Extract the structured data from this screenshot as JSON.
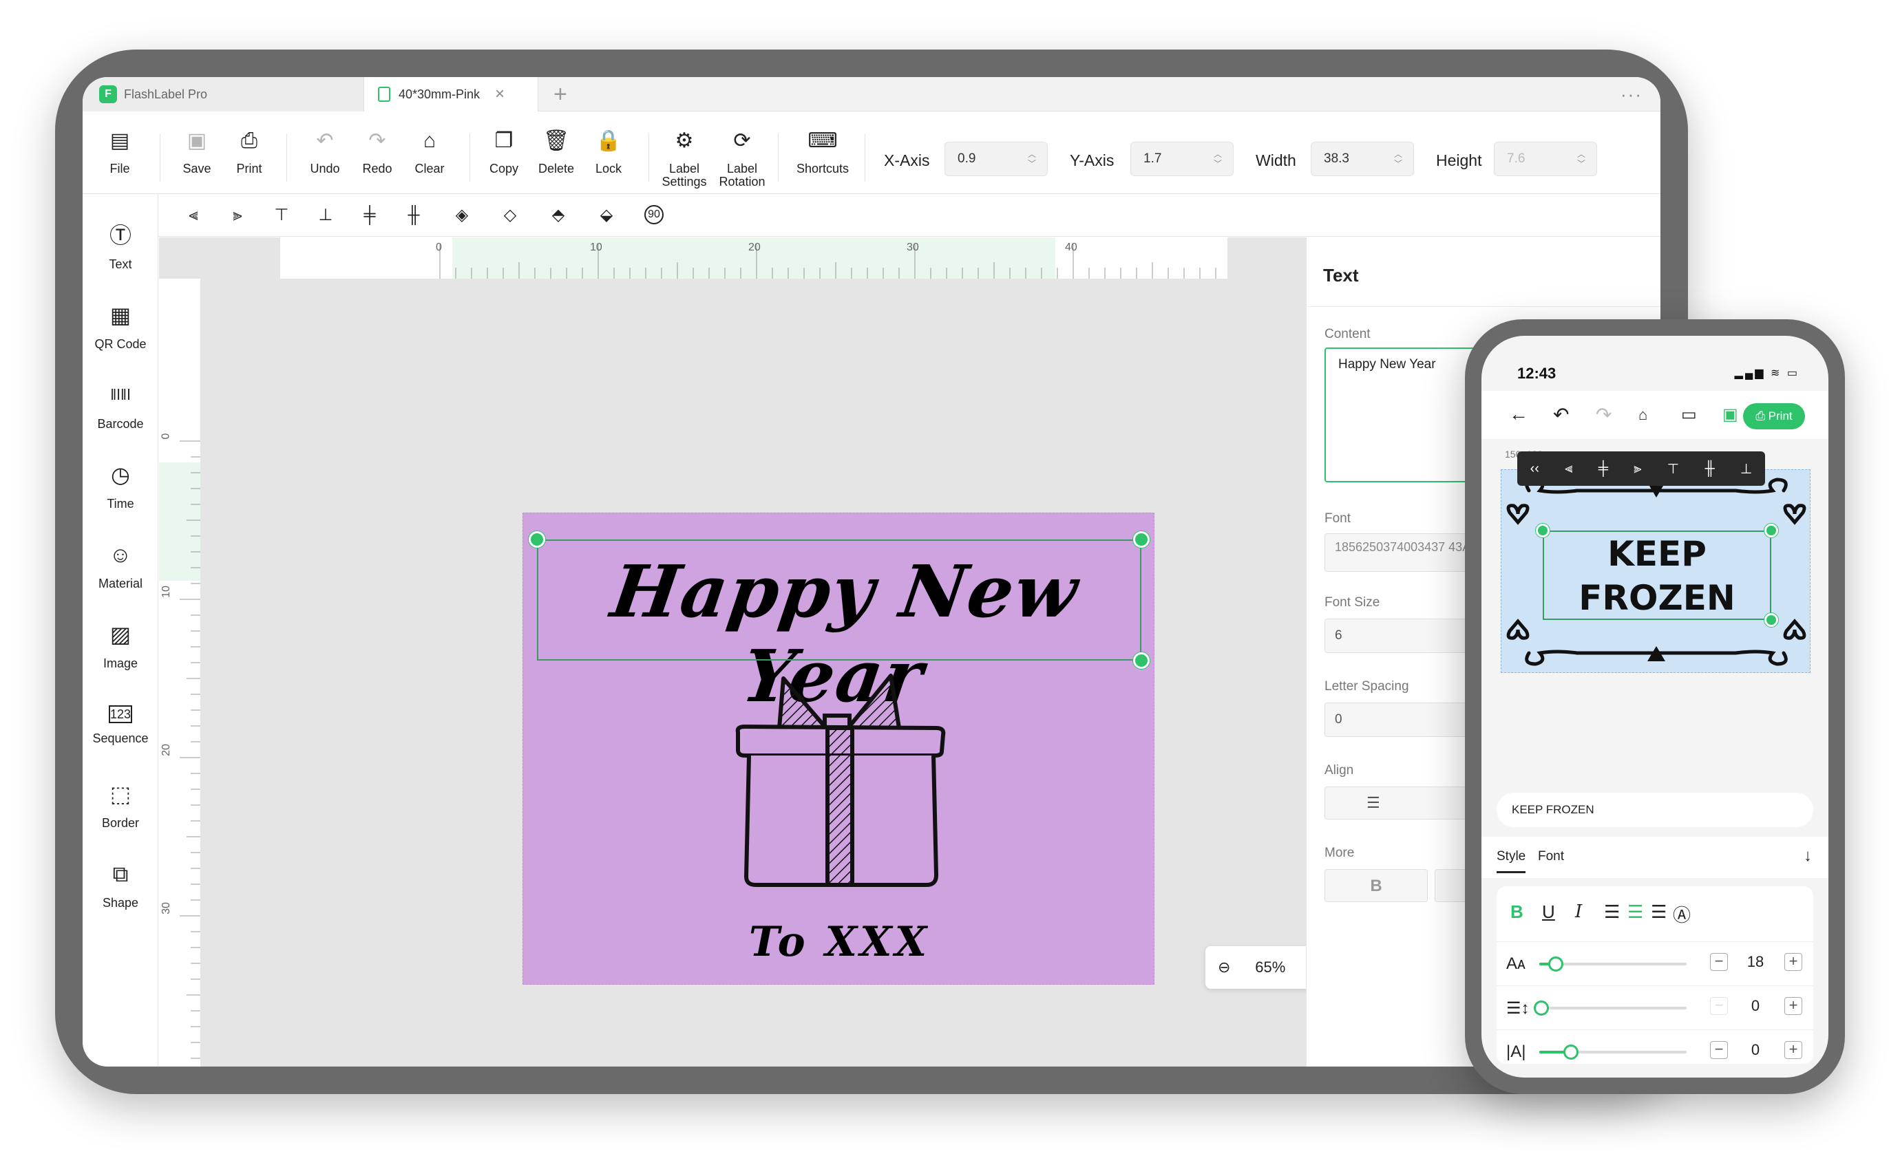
{
  "app": {
    "name": "FlashLabel Pro",
    "doc_tab": "40*30mm-Pink"
  },
  "toolbar": {
    "file": "File",
    "save": "Save",
    "print": "Print",
    "undo": "Undo",
    "redo": "Redo",
    "clear": "Clear",
    "copy": "Copy",
    "delete": "Delete",
    "lock": "Lock",
    "label_settings": "Label Settings",
    "label_rotation": "Label Rotation",
    "shortcuts": "Shortcuts",
    "x_axis_label": "X-Axis",
    "x_axis_value": "0.9",
    "y_axis_label": "Y-Axis",
    "y_axis_value": "1.7",
    "width_label": "Width",
    "width_value": "38.3",
    "height_label": "Height",
    "height_value": "7.6"
  },
  "sidebar": {
    "items": [
      {
        "label": "Text",
        "icon": "text-icon"
      },
      {
        "label": "QR Code",
        "icon": "qr-code-icon"
      },
      {
        "label": "Barcode",
        "icon": "barcode-icon"
      },
      {
        "label": "Time",
        "icon": "clock-icon"
      },
      {
        "label": "Material",
        "icon": "smiley-icon"
      },
      {
        "label": "Image",
        "icon": "image-icon"
      },
      {
        "label": "Sequence",
        "icon": "sequence-icon"
      },
      {
        "label": "Border",
        "icon": "border-icon"
      },
      {
        "label": "Shape",
        "icon": "shape-icon"
      }
    ]
  },
  "ruler": {
    "h_ticks": [
      "0",
      "10",
      "20",
      "30",
      "40"
    ],
    "v_ticks": [
      "0",
      "10",
      "20",
      "30"
    ]
  },
  "canvas": {
    "title_text": "Happy New Year",
    "footer_text": "To XXX",
    "zoom": "65%",
    "label_color": "#cfa2e0"
  },
  "panel": {
    "title": "Text",
    "content_label": "Content",
    "content_value": "Happy New Year",
    "font_label": "Font",
    "font_value": "1856250374003437 43A583.ttf",
    "font_size_label": "Font Size",
    "font_size_value": "6",
    "letter_spacing_label": "Letter Spacing",
    "letter_spacing_value": "0",
    "align_label": "Align",
    "more_label": "More"
  },
  "phone": {
    "time": "12:43",
    "status": "battery 83",
    "print_label": "Print",
    "size_label": "150×100mm",
    "label_text_line1": "KEEP",
    "label_text_line2": "FROZEN",
    "text_input": "KEEP FROZEN",
    "tab_style": "Style",
    "tab_font": "Font",
    "font_size_value": "18",
    "font_size_level": 0.1,
    "line_spacing_value": "0",
    "line_spacing_level": 0.0,
    "letter_spacing_value": "0",
    "letter_spacing_level": 0.2,
    "accent_color": "#2ec26b",
    "label_color": "#cfe3f6"
  }
}
